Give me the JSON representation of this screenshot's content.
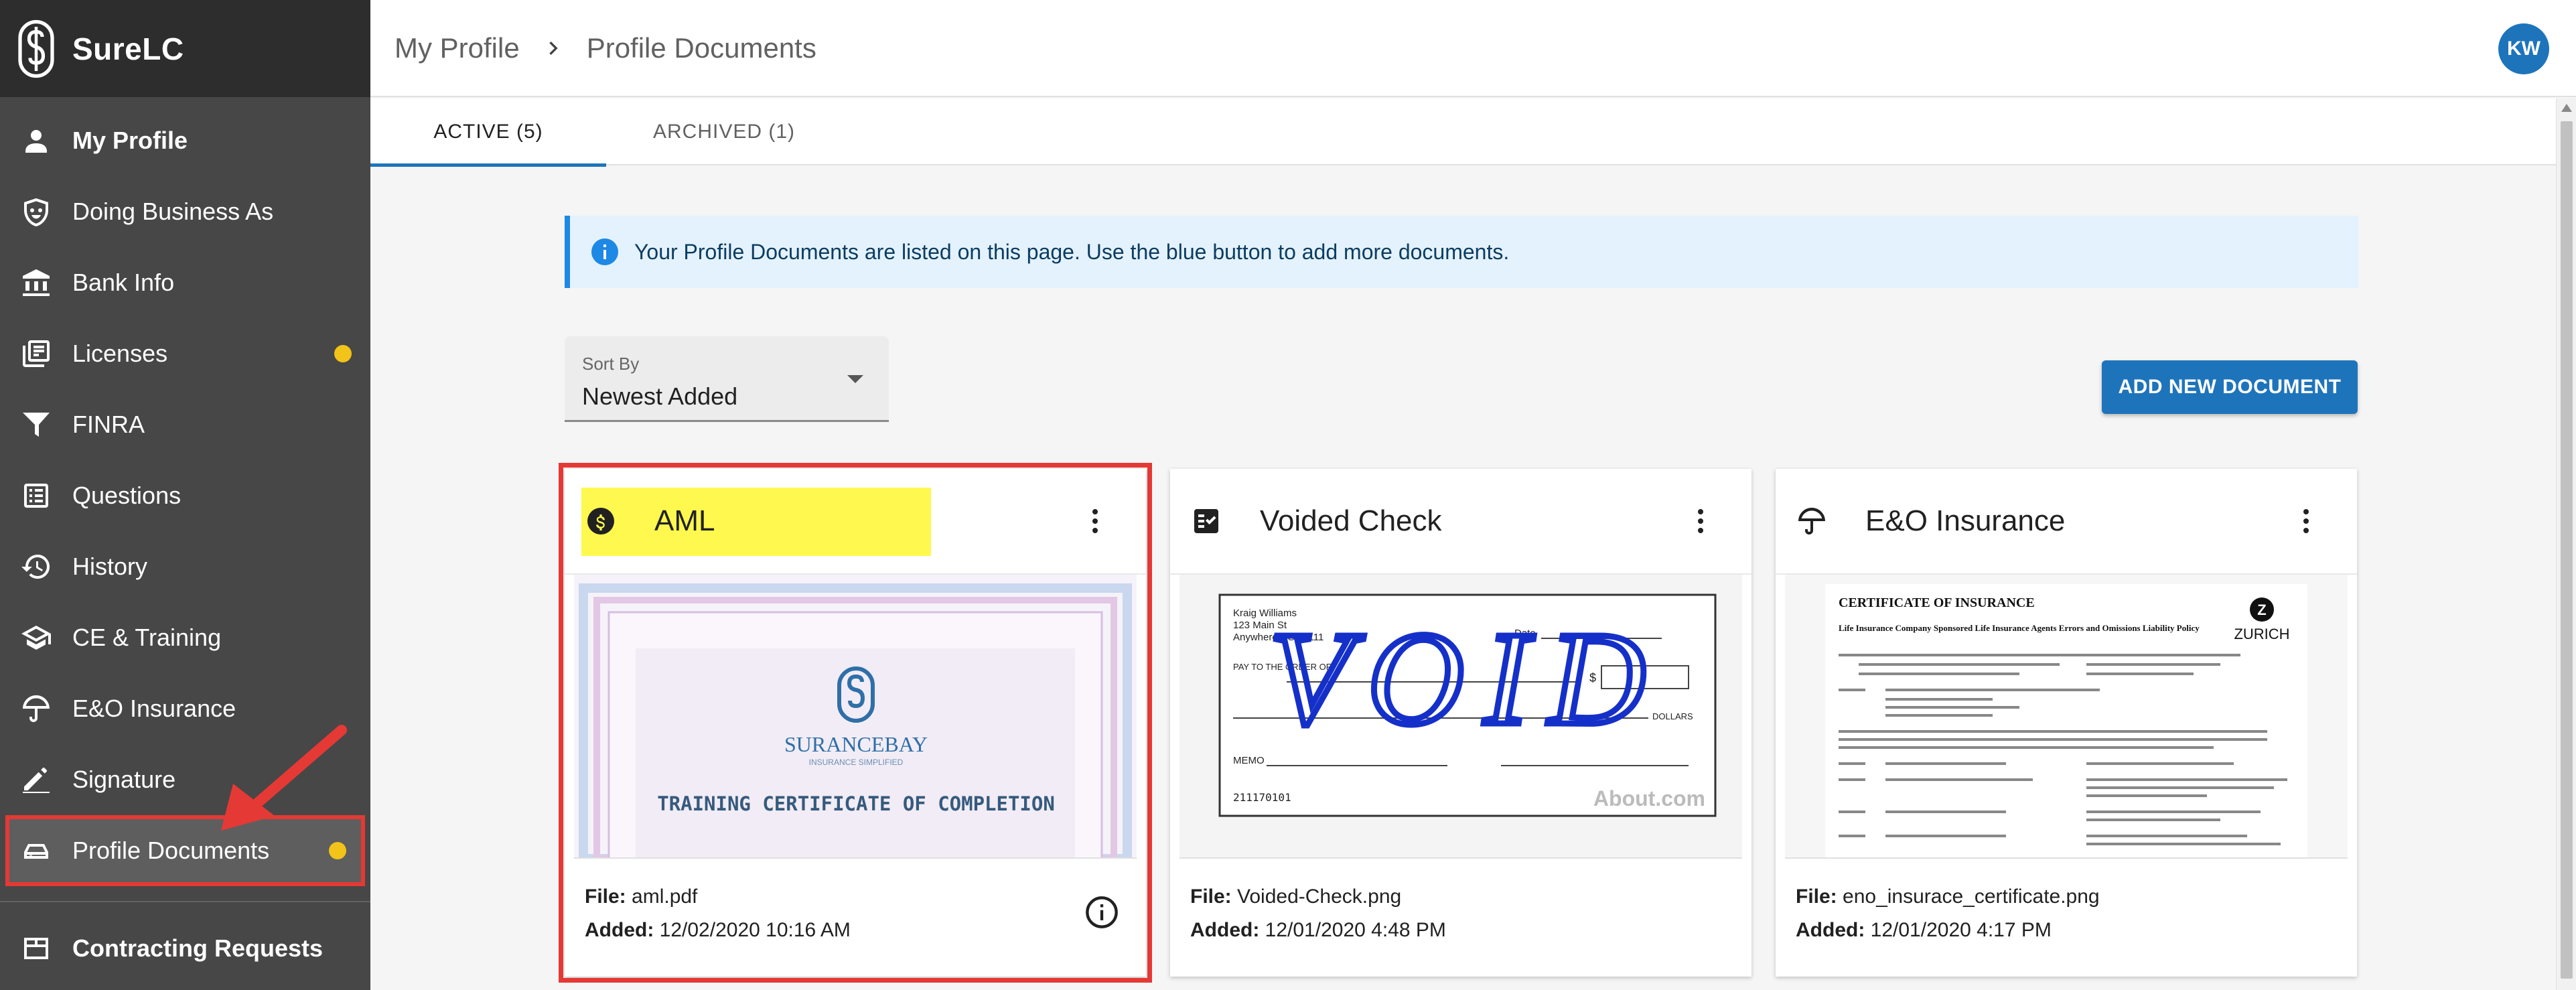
{
  "app": {
    "name": "SureLC",
    "user_initials": "KW"
  },
  "sidebar": {
    "items": [
      {
        "label": "My Profile",
        "icon": "person-icon",
        "bold": true
      },
      {
        "label": "Doing Business As",
        "icon": "mask-badge-icon"
      },
      {
        "label": "Bank Info",
        "icon": "bank-icon"
      },
      {
        "label": "Licenses",
        "icon": "license-icon",
        "dot": true
      },
      {
        "label": "FINRA",
        "icon": "finra-icon"
      },
      {
        "label": "Questions",
        "icon": "list-icon"
      },
      {
        "label": "History",
        "icon": "history-icon"
      },
      {
        "label": "CE & Training",
        "icon": "graduation-cap-icon"
      },
      {
        "label": "E&O Insurance",
        "icon": "umbrella-icon"
      },
      {
        "label": "Signature",
        "icon": "pen-icon"
      },
      {
        "label": "Profile Documents",
        "icon": "document-tray-icon",
        "dot": true,
        "active": true
      }
    ],
    "section": "Contracting Requests",
    "dot_color": "#f2c318"
  },
  "breadcrumb": {
    "parent": "My Profile",
    "current": "Profile Documents"
  },
  "tabs": [
    {
      "label": "ACTIVE (5)",
      "active": true
    },
    {
      "label": "ARCHIVED (1)"
    }
  ],
  "banner": {
    "text": "Your Profile Documents are listed on this page. Use the blue button to add more documents."
  },
  "sort": {
    "label": "Sort By",
    "value": "Newest Added"
  },
  "add_button": "ADD NEW DOCUMENT",
  "file_label": "File:",
  "added_label": "Added:",
  "cards": [
    {
      "title": "AML",
      "file": "aml.pdf",
      "added": "12/02/2020 10:16 AM",
      "preview": {
        "brand": "SURANCEBAY",
        "tagline": "INSURANCE SIMPLIFIED",
        "caption": "TRAINING CERTIFICATE OF COMPLETION"
      }
    },
    {
      "title": "Voided Check",
      "file": "Voided-Check.png",
      "added": "12/01/2020 4:48 PM",
      "preview": {
        "name": "Kraig Williams",
        "street": "123 Main St",
        "city": "Anywhere US 10111",
        "pay": "PAY TO THE ORDER OF",
        "date": "Date",
        "memo": "MEMO",
        "routing": "211170101",
        "dollar": "$",
        "dollars": "DOLLARS",
        "void": "VOID",
        "watermark": "About.com"
      }
    },
    {
      "title": "E&O Insurance",
      "file": "eno_insurace_certificate.png",
      "added": "12/01/2020 4:17 PM",
      "preview": {
        "heading": "CERTIFICATE OF INSURANCE",
        "subheading": "Life Insurance Company Sponsored Life Insurance Agents Errors and Omissions Liability Policy",
        "insurer": "ZURICH"
      }
    }
  ],
  "colors": {
    "accent": "#1e74bb",
    "annotation": "#e53935",
    "highlight": "#fff84f"
  }
}
